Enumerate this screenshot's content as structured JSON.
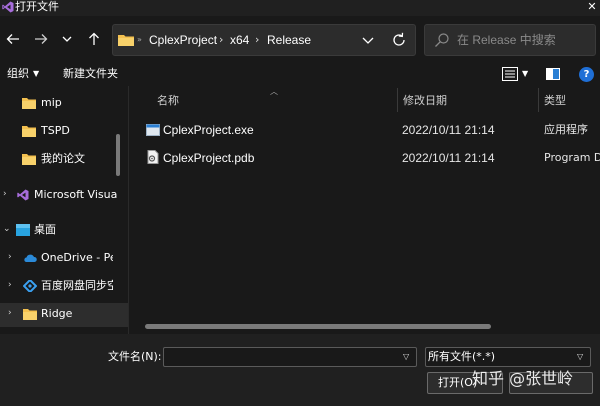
{
  "window": {
    "title": "打开文件",
    "close_glyph": "✕"
  },
  "nav_buttons": {
    "back": "←",
    "forward": "→",
    "recent": "⌄",
    "up": "↑"
  },
  "address": {
    "crumbs": [
      "CplexProject",
      "x64",
      "Release"
    ],
    "separator": "›"
  },
  "search": {
    "placeholder": "在 Release 中搜索"
  },
  "toolbar": {
    "organize": "组织",
    "new_folder": "新建文件夹"
  },
  "sidebar": {
    "items": [
      {
        "label": "mip",
        "icon": "folder-icon"
      },
      {
        "label": "TSPD",
        "icon": "folder-icon"
      },
      {
        "label": "我的论文",
        "icon": "folder-icon"
      },
      {
        "label": "Microsoft Visua",
        "icon": "visual-studio-icon"
      },
      {
        "label": "桌面",
        "icon": "desktop-icon"
      },
      {
        "label": "OneDrive - Pe",
        "icon": "cloud-icon"
      },
      {
        "label": "百度网盘同步空",
        "icon": "baidu-netdisk-icon"
      },
      {
        "label": "Ridge",
        "icon": "folder-icon"
      }
    ]
  },
  "columns": {
    "name": "名称",
    "modified": "修改日期",
    "type": "类型"
  },
  "files": [
    {
      "name": "CplexProject.exe",
      "modified": "2022/10/11 21:14",
      "type": "应用程序",
      "icon": "exe-icon"
    },
    {
      "name": "CplexProject.pdb",
      "modified": "2022/10/11 21:14",
      "type": "Program Debug Database",
      "icon": "pdb-file-icon"
    }
  ],
  "bottom": {
    "filename_label": "文件名(N):",
    "filename_value": "",
    "filter_value": "所有文件(*.*)",
    "open_label": "打开(O)",
    "cancel_label": ""
  },
  "watermark": "知乎 @张世岭",
  "colors": {
    "background": "#191919",
    "panel": "#202020",
    "accent": "#1f6fd6",
    "folder": "#f3c04f"
  }
}
